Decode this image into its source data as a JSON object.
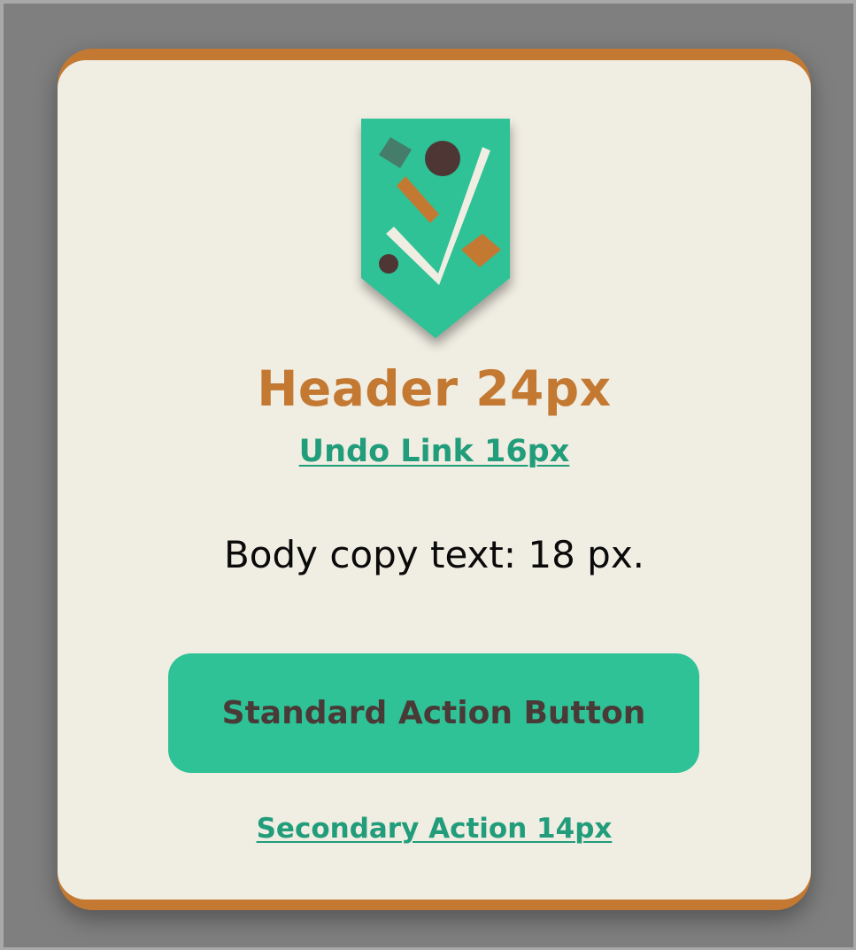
{
  "colors": {
    "page_background": "#7f7f7f",
    "card_border": "#c47932",
    "card_background": "#f0ede2",
    "brand_teal": "#2ec296",
    "link_teal": "#229d7b",
    "heading_orange": "#c47932",
    "body_text": "#0a0a0a",
    "button_text": "#4a3a37",
    "badge_dark": "#4e3634",
    "badge_slate": "#457c6a",
    "badge_check": "#f0ede2"
  },
  "badge": {
    "icon": "checkmark-badge-icon"
  },
  "card": {
    "header": "Header 24px",
    "undo_link": "Undo Link 16px",
    "body_copy": "Body copy text: 18 px.",
    "primary_button": "Standard Action Button",
    "secondary_link": "Secondary Action 14px"
  }
}
